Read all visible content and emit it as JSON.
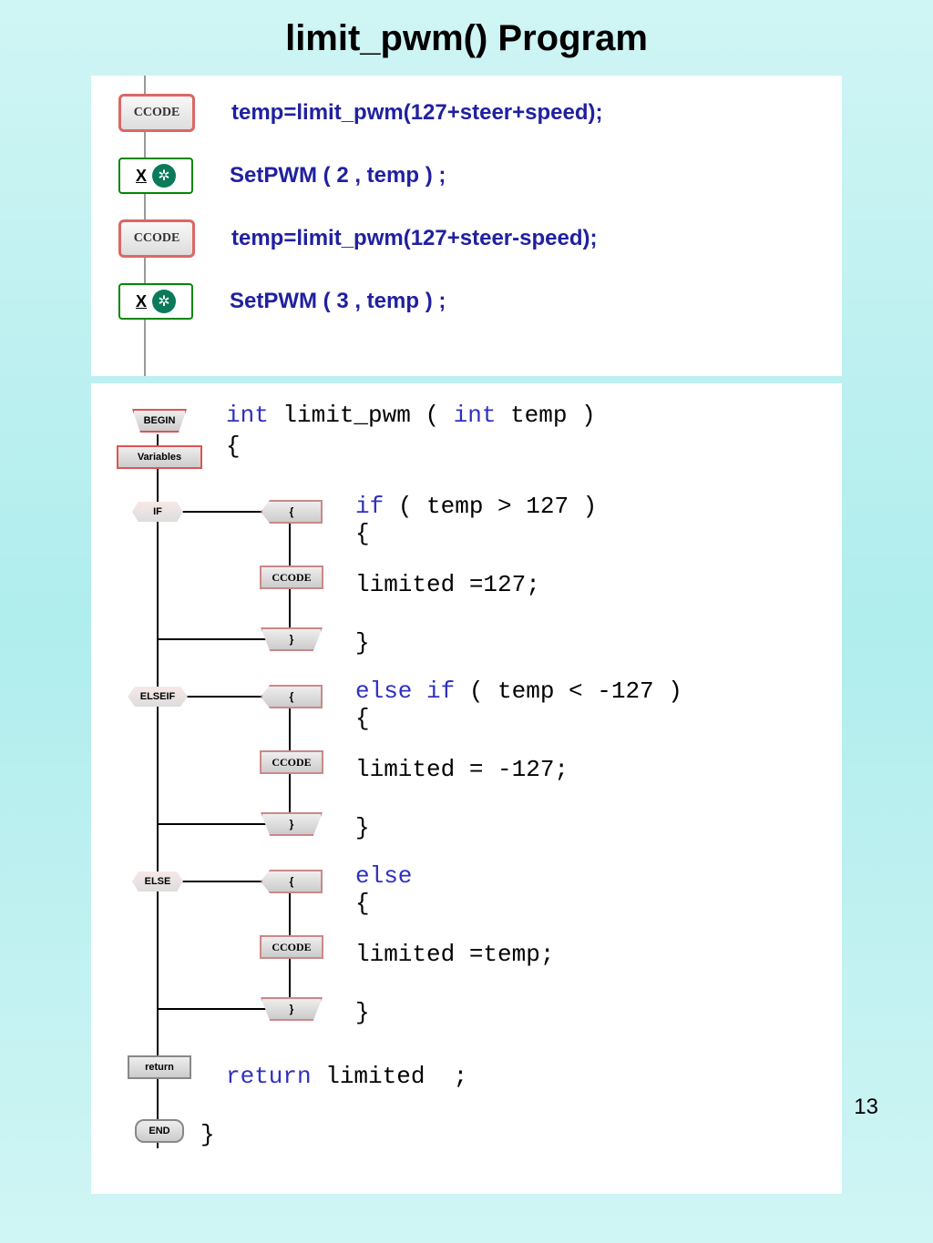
{
  "title": "limit_pwm() Program",
  "page_number": "13",
  "panel1": {
    "rows": [
      {
        "block": "CCODE",
        "text": "temp=limit_pwm(127+steer+speed);"
      },
      {
        "block": "XGEAR",
        "text": "SetPWM ( 2 , temp ) ;"
      },
      {
        "block": "CCODE",
        "text": "temp=limit_pwm(127+steer-speed);"
      },
      {
        "block": "XGEAR",
        "text": "SetPWM ( 3 , temp ) ;"
      }
    ],
    "ccode_label": "CCODE",
    "x_label": "X"
  },
  "panel2": {
    "nodes": {
      "begin": "BEGIN",
      "variables": "Variables",
      "if": "IF",
      "elseif": "ELSEIF",
      "else": "ELSE",
      "return": "return",
      "end": "END",
      "open_brace": "{",
      "close_brace": "}",
      "ccode": "CCODE"
    },
    "code": {
      "sig_kw": "int",
      "sig_name": " limit_pwm ( ",
      "sig_arg": "int",
      "sig_rest": " temp )",
      "open": "{",
      "if_kw": "if",
      "if_cond": " ( temp > 127 )",
      "if_open": "{",
      "if_body": "limited =127;",
      "if_close": "}",
      "elseif_kw": "else if",
      "elseif_cond": " ( temp < -127 )",
      "elseif_open": "{",
      "elseif_body": "limited = -127;",
      "elseif_close": "}",
      "else_kw": "else",
      "else_open": "{",
      "else_body": "limited =temp;",
      "else_close": "}",
      "ret_kw": "return",
      "ret_rest": " limited  ;",
      "close": "}"
    }
  }
}
